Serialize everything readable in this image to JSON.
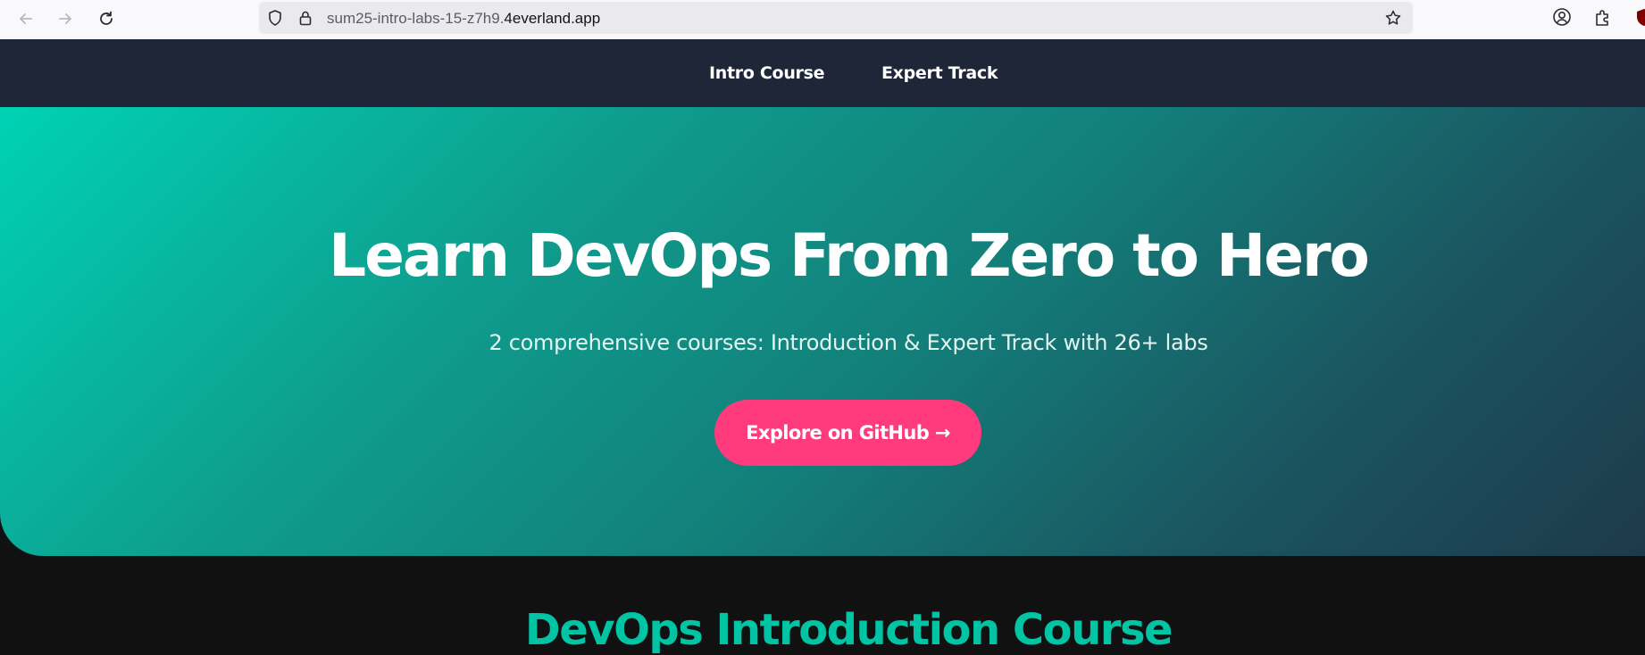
{
  "browser": {
    "url_prefix": "sum25-intro-labs-15-z7h9.",
    "url_domain": "4everland.app",
    "icons": [
      "back-icon",
      "forward-icon",
      "reload-icon",
      "shield-icon",
      "lock-icon",
      "bookmark-star-icon",
      "account-icon",
      "extensions-icon",
      "ublock-icon"
    ]
  },
  "nav": {
    "items": [
      {
        "label": "Intro Course"
      },
      {
        "label": "Expert Track"
      }
    ]
  },
  "hero": {
    "title": "Learn DevOps From Zero to Hero",
    "subtitle": "2 comprehensive courses: Introduction & Expert Track with 26+ labs",
    "cta_label": "Explore on GitHub →"
  },
  "section": {
    "title": "DevOps Introduction Course"
  },
  "colors": {
    "nav_bg": "#1e2638",
    "hero_gradient_start": "#00d2b4",
    "hero_gradient_end": "#1e3a4a",
    "cta_bg": "#ff3a7d",
    "section_title": "#00c4a4",
    "page_bg": "#111111"
  }
}
